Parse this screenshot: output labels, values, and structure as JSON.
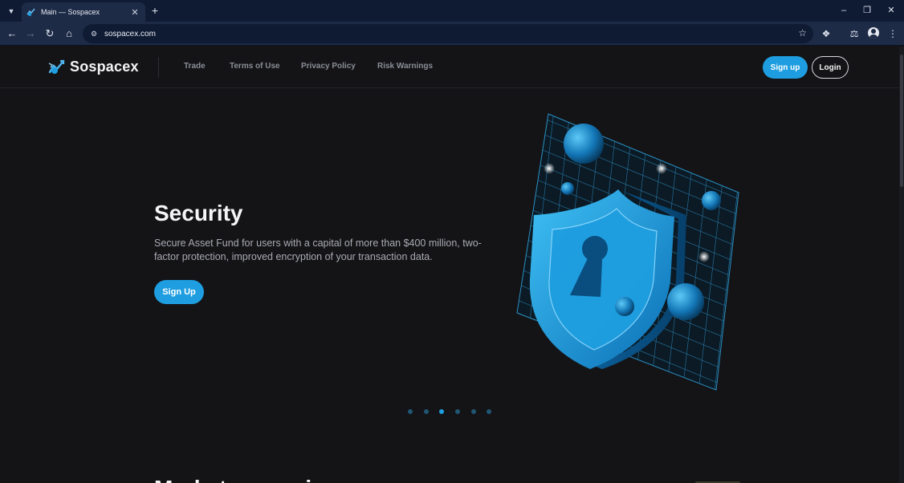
{
  "browser": {
    "tab_title": "Main — Sospacex",
    "tab_close_icon": "close-icon",
    "new_tab_icon": "plus-icon",
    "url": "sospacex.com",
    "window_controls": [
      "minimize-icon",
      "restore-icon",
      "close-icon"
    ]
  },
  "header": {
    "brand": "Sospacex",
    "nav": [
      {
        "label": "Trade"
      },
      {
        "label": "Terms of Use"
      },
      {
        "label": "Privacy Policy"
      },
      {
        "label": "Risk Warnings"
      }
    ],
    "signup_label": "Sign up",
    "login_label": "Login"
  },
  "hero": {
    "title": "Security",
    "description": "Secure Asset Fund for users with a capital of more than $400 million, two-factor protection, improved encryption of your transaction data.",
    "cta_label": "Sign Up",
    "slide_count": 6,
    "active_slide": 3
  },
  "next_section": {
    "heading": "Markets overview"
  },
  "colors": {
    "accent": "#1e9ee0",
    "background": "#141417",
    "browser_frame": "#0f1b33",
    "browser_toolbar": "#1e2b47"
  }
}
